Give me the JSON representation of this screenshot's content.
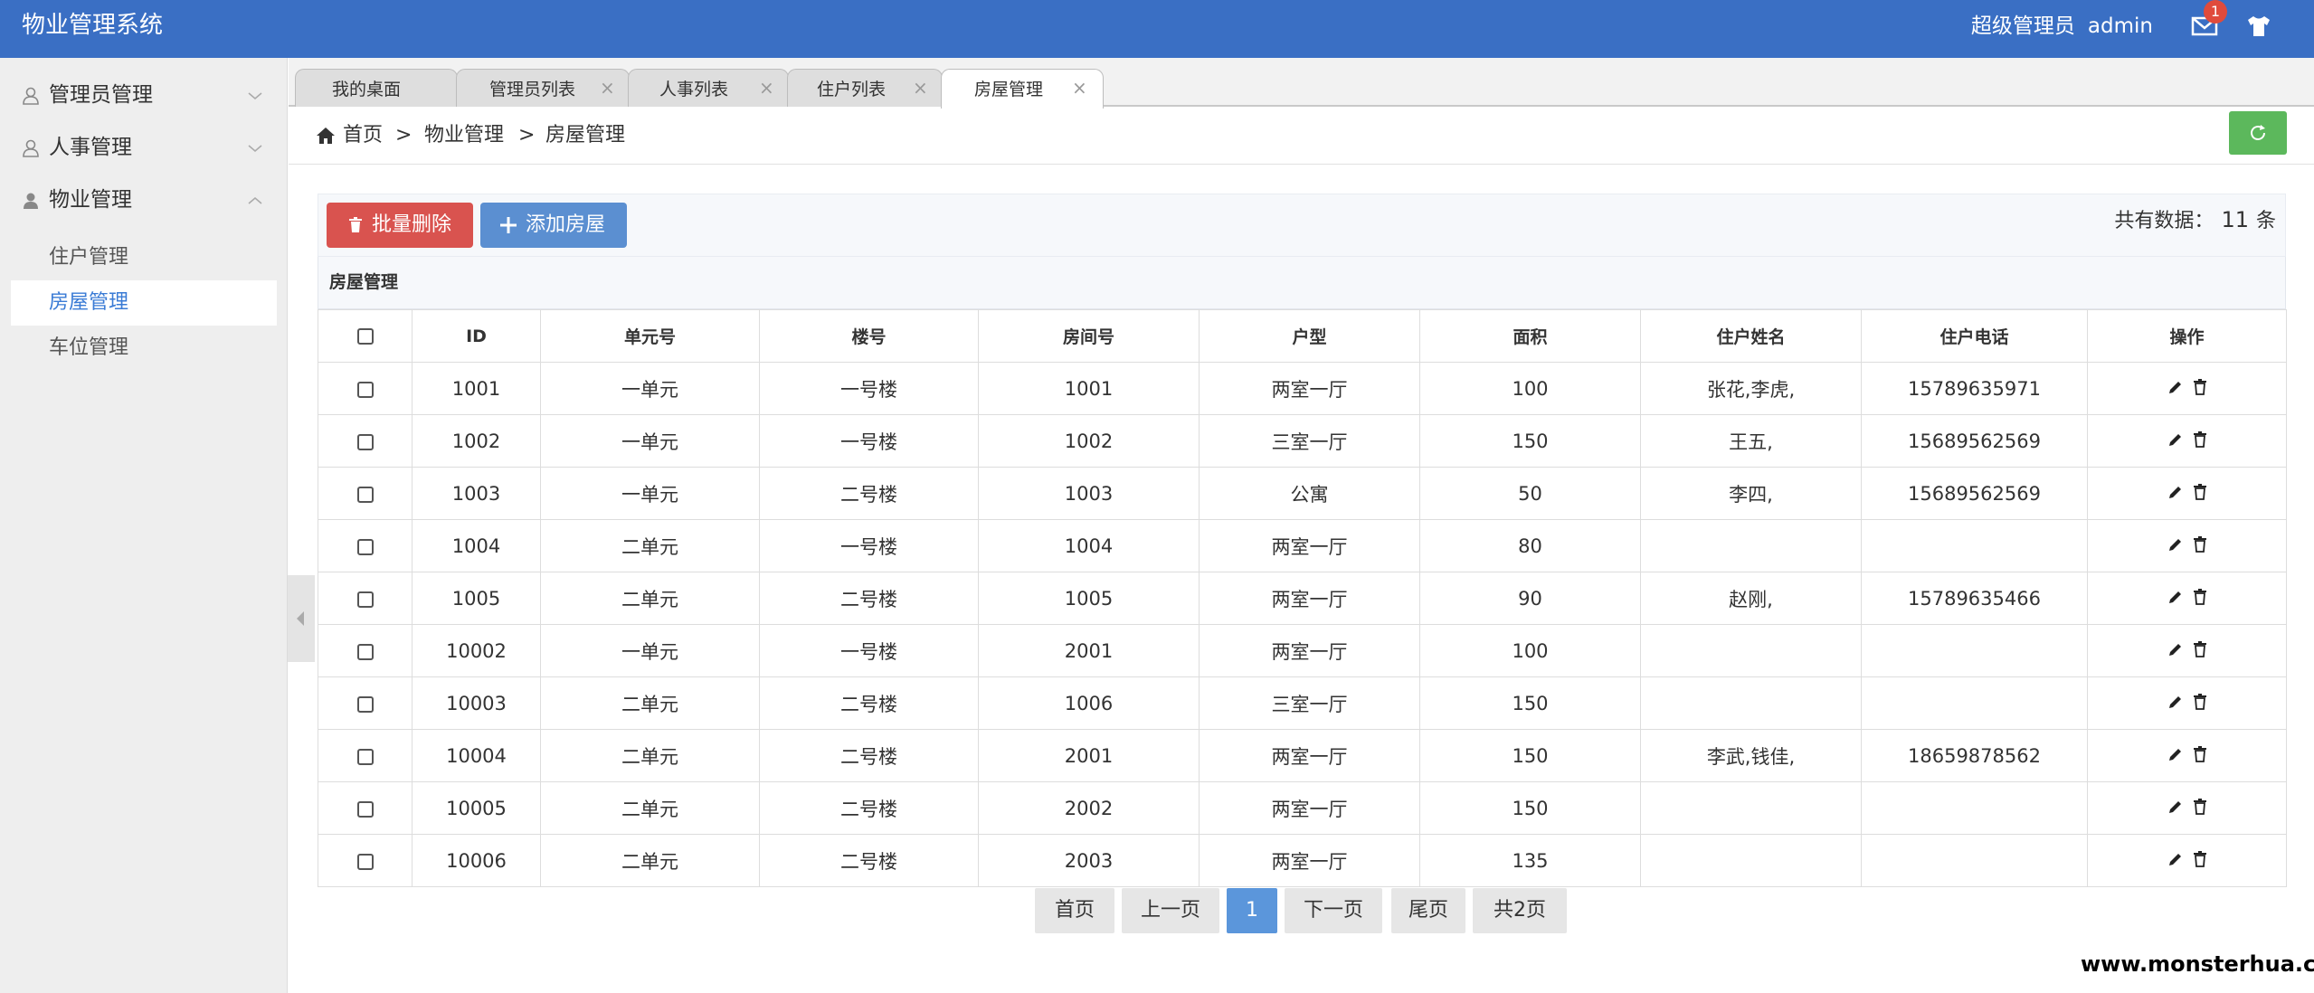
{
  "header": {
    "app_title": "物业管理系统",
    "user_role": "超级管理员",
    "user_name": "admin",
    "notification_count": "1"
  },
  "sidebar": {
    "groups": [
      {
        "label": "管理员管理",
        "icon": "user-outline-icon",
        "expanded": false
      },
      {
        "label": "人事管理",
        "icon": "user-outline-icon",
        "expanded": false
      },
      {
        "label": "物业管理",
        "icon": "user-filled-icon",
        "expanded": true
      }
    ],
    "sub_items": [
      {
        "label": "住户管理",
        "active": false
      },
      {
        "label": "房屋管理",
        "active": true
      },
      {
        "label": "车位管理",
        "active": false
      }
    ]
  },
  "tabs": [
    {
      "label": "我的桌面",
      "closable": false
    },
    {
      "label": "管理员列表",
      "closable": true
    },
    {
      "label": "人事列表",
      "closable": true
    },
    {
      "label": "住户列表",
      "closable": true
    },
    {
      "label": "房屋管理",
      "closable": true,
      "active": true
    }
  ],
  "breadcrumb": {
    "home": "首页",
    "sep": ">",
    "level1": "物业管理",
    "level2": "房屋管理"
  },
  "toolbar": {
    "batch_delete_label": "批量删除",
    "add_label": "添加房屋",
    "total_prefix": "共有数据：",
    "total_count": "11",
    "total_suffix": "条"
  },
  "panel": {
    "title": "房屋管理"
  },
  "table": {
    "columns": [
      "ID",
      "单元号",
      "楼号",
      "房间号",
      "户型",
      "面积",
      "住户姓名",
      "住户电话",
      "操作"
    ],
    "rows": [
      [
        "1001",
        "一单元",
        "一号楼",
        "1001",
        "两室一厅",
        "100",
        "张花,李虎,",
        "15789635971"
      ],
      [
        "1002",
        "一单元",
        "一号楼",
        "1002",
        "三室一厅",
        "150",
        "王五,",
        "15689562569"
      ],
      [
        "1003",
        "一单元",
        "二号楼",
        "1003",
        "公寓",
        "50",
        "李四,",
        "15689562569"
      ],
      [
        "1004",
        "二单元",
        "一号楼",
        "1004",
        "两室一厅",
        "80",
        "",
        ""
      ],
      [
        "1005",
        "二单元",
        "二号楼",
        "1005",
        "两室一厅",
        "90",
        "赵刚,",
        "15789635466"
      ],
      [
        "10002",
        "一单元",
        "一号楼",
        "2001",
        "两室一厅",
        "100",
        "",
        ""
      ],
      [
        "10003",
        "二单元",
        "二号楼",
        "1006",
        "三室一厅",
        "150",
        "",
        ""
      ],
      [
        "10004",
        "二单元",
        "二号楼",
        "2001",
        "两室一厅",
        "150",
        "李武,钱佳,",
        "18659878562"
      ],
      [
        "10005",
        "二单元",
        "二号楼",
        "2002",
        "两室一厅",
        "150",
        "",
        ""
      ],
      [
        "10006",
        "二单元",
        "二号楼",
        "2003",
        "两室一厅",
        "135",
        "",
        ""
      ]
    ]
  },
  "pagination": {
    "first": "首页",
    "prev": "上一页",
    "current": "1",
    "next": "下一页",
    "last": "尾页",
    "total_pages": "共2页"
  },
  "watermark": "www.monsterhua.com",
  "colors": {
    "header_bg": "#3a6fc4",
    "danger": "#d9534f",
    "primary": "#5b8fd1",
    "success": "#5cb85c",
    "active_link": "#3a7bd5"
  }
}
